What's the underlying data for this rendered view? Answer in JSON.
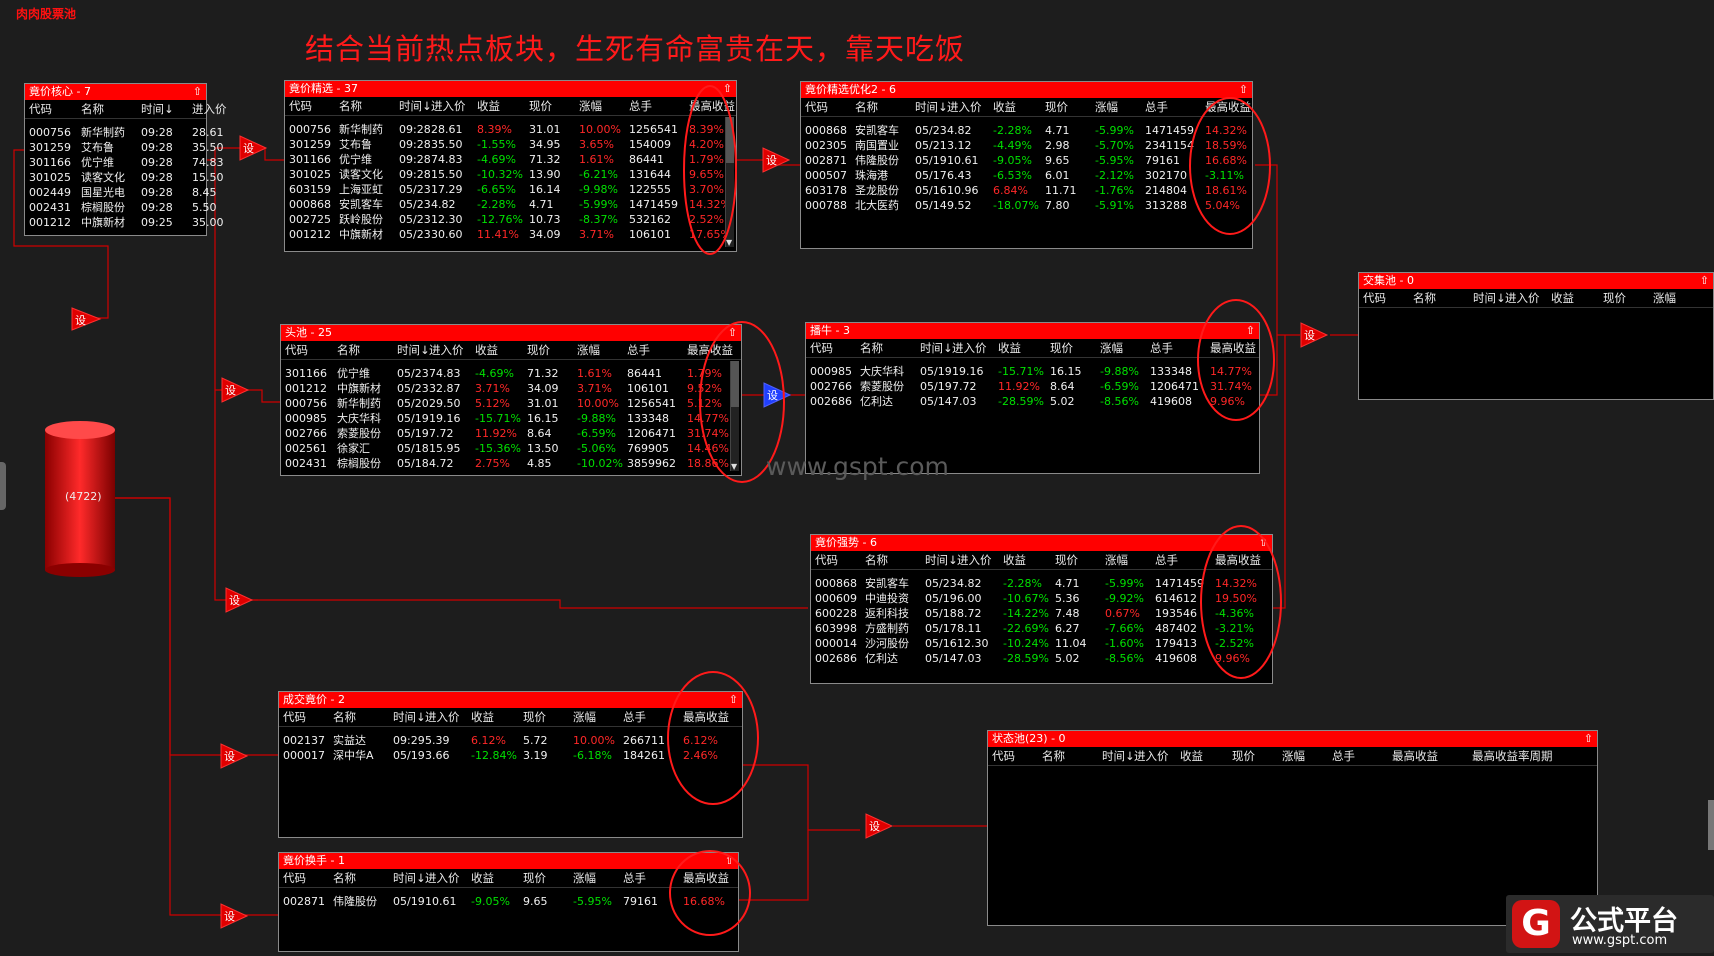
{
  "app_title": "肉肉股票池",
  "headline": "结合当前热点板块，生死有命富贵在天，靠天吃饭",
  "watermark": "www.gspt.com",
  "database": {
    "label": "(4722)"
  },
  "node_label": "设",
  "brand": {
    "logo_char": "G",
    "name": "公式平台",
    "url": "www.gspt.com"
  },
  "colors": {
    "accent": "#ff0000",
    "positive": "#ff2828",
    "negative": "#00e000",
    "background": "#1d1d1d"
  },
  "panels": {
    "hexin": {
      "title": "竟价核心 - 7",
      "cols": [
        "代码",
        "名称",
        "时间↓",
        "进入价"
      ],
      "rows": [
        [
          "000756",
          "新华制药",
          "09:28",
          "28.61"
        ],
        [
          "301259",
          "艾布鲁",
          "09:28",
          "35.50"
        ],
        [
          "301166",
          "优宁维",
          "09:28",
          "74.83"
        ],
        [
          "301025",
          "读客文化",
          "09:28",
          "15.50"
        ],
        [
          "002449",
          "国星光电",
          "09:28",
          "8.45"
        ],
        [
          "002431",
          "棕榈股份",
          "09:28",
          "5.50"
        ],
        [
          "001212",
          "中旗新材",
          "09:25",
          "35.00"
        ]
      ]
    },
    "jingxuan": {
      "title": "竟价精选 - 37",
      "cols": [
        "代码",
        "名称",
        "时间↓",
        "进入价",
        "收益",
        "现价",
        "涨幅",
        "总手",
        "最高收益"
      ],
      "rows": [
        [
          "000756",
          "新华制药",
          "09:28",
          "28.61",
          "8.39%",
          "31.01",
          "10.00%",
          "1256541",
          "8.39%"
        ],
        [
          "301259",
          "艾布鲁",
          "09:28",
          "35.50",
          "-1.55%",
          "34.95",
          "3.65%",
          "154009",
          "4.20%"
        ],
        [
          "301166",
          "优宁维",
          "09:28",
          "74.83",
          "-4.69%",
          "71.32",
          "1.61%",
          "86441",
          "1.79%"
        ],
        [
          "301025",
          "读客文化",
          "09:28",
          "15.50",
          "-10.32%",
          "13.90",
          "-6.21%",
          "131644",
          "9.65%"
        ],
        [
          "603159",
          "上海亚虹",
          "05/23",
          "17.29",
          "-6.65%",
          "16.14",
          "-9.98%",
          "122555",
          "3.70%"
        ],
        [
          "000868",
          "安凯客车",
          "05/23",
          "4.82",
          "-2.28%",
          "4.71",
          "-5.99%",
          "1471459",
          "14.32%"
        ],
        [
          "002725",
          "跃岭股份",
          "05/23",
          "12.30",
          "-12.76%",
          "10.73",
          "-8.37%",
          "532162",
          "2.52%"
        ],
        [
          "001212",
          "中旗新材",
          "05/23",
          "30.60",
          "11.41%",
          "34.09",
          "3.71%",
          "106101",
          "17.65%"
        ]
      ]
    },
    "youhua": {
      "title": "竟价精选优化2 - 6",
      "cols": [
        "代码",
        "名称",
        "时间↓",
        "进入价",
        "收益",
        "现价",
        "涨幅",
        "总手",
        "最高收益"
      ],
      "rows": [
        [
          "000868",
          "安凯客车",
          "05/23",
          "4.82",
          "-2.28%",
          "4.71",
          "-5.99%",
          "1471459",
          "14.32%"
        ],
        [
          "002305",
          "南国置业",
          "05/21",
          "3.12",
          "-4.49%",
          "2.98",
          "-5.70%",
          "2341154",
          "18.59%"
        ],
        [
          "002871",
          "伟隆股份",
          "05/19",
          "10.61",
          "-9.05%",
          "9.65",
          "-5.95%",
          "79161",
          "16.68%"
        ],
        [
          "000507",
          "珠海港",
          "05/17",
          "6.43",
          "-6.53%",
          "6.01",
          "-2.12%",
          "302170",
          "-3.11%"
        ],
        [
          "603178",
          "圣龙股份",
          "05/16",
          "10.96",
          "6.84%",
          "11.71",
          "-1.76%",
          "214804",
          "18.61%"
        ],
        [
          "000788",
          "北大医药",
          "05/14",
          "9.52",
          "-18.07%",
          "7.80",
          "-5.91%",
          "313288",
          "5.04%"
        ]
      ]
    },
    "jiaoji": {
      "title": "交集池 - 0",
      "cols": [
        "代码",
        "名称",
        "时间↓",
        "进入价",
        "收益",
        "现价",
        "涨幅"
      ],
      "rows": []
    },
    "toutou": {
      "title": "头池 - 25",
      "cols": [
        "代码",
        "名称",
        "时间↓",
        "进入价",
        "收益",
        "现价",
        "涨幅",
        "总手",
        "最高收益"
      ],
      "rows": [
        [
          "301166",
          "优宁维",
          "05/23",
          "74.83",
          "-4.69%",
          "71.32",
          "1.61%",
          "86441",
          "1.79%"
        ],
        [
          "001212",
          "中旗新材",
          "05/23",
          "32.87",
          "3.71%",
          "34.09",
          "3.71%",
          "106101",
          "9.52%"
        ],
        [
          "000756",
          "新华制药",
          "05/20",
          "29.50",
          "5.12%",
          "31.01",
          "10.00%",
          "1256541",
          "5.12%"
        ],
        [
          "000985",
          "大庆华科",
          "05/19",
          "19.16",
          "-15.71%",
          "16.15",
          "-9.88%",
          "133348",
          "14.77%"
        ],
        [
          "002766",
          "索菱股份",
          "05/19",
          "7.72",
          "11.92%",
          "8.64",
          "-6.59%",
          "1206471",
          "31.74%"
        ],
        [
          "002561",
          "徐家汇",
          "05/18",
          "15.95",
          "-15.36%",
          "13.50",
          "-5.06%",
          "769905",
          "14.46%"
        ],
        [
          "002431",
          "棕榈股份",
          "05/18",
          "4.72",
          "2.75%",
          "4.85",
          "-10.02%",
          "3859962",
          "18.86%"
        ]
      ]
    },
    "bozhong": {
      "title": "播牛 - 3",
      "cols": [
        "代码",
        "名称",
        "时间↓",
        "进入价",
        "收益",
        "现价",
        "涨幅",
        "总手",
        "最高收益"
      ],
      "rows": [
        [
          "000985",
          "大庆华科",
          "05/19",
          "19.16",
          "-15.71%",
          "16.15",
          "-9.88%",
          "133348",
          "14.77%"
        ],
        [
          "002766",
          "索菱股份",
          "05/19",
          "7.72",
          "11.92%",
          "8.64",
          "-6.59%",
          "1206471",
          "31.74%"
        ],
        [
          "002686",
          "亿利达",
          "05/14",
          "7.03",
          "-28.59%",
          "5.02",
          "-8.56%",
          "419608",
          "9.96%"
        ]
      ]
    },
    "qiangshi": {
      "title": "竟价强势 - 6",
      "cols": [
        "代码",
        "名称",
        "时间↓",
        "进入价",
        "收益",
        "现价",
        "涨幅",
        "总手",
        "最高收益"
      ],
      "rows": [
        [
          "000868",
          "安凯客车",
          "05/23",
          "4.82",
          "-2.28%",
          "4.71",
          "-5.99%",
          "1471459",
          "14.32%"
        ],
        [
          "000609",
          "中迪投资",
          "05/19",
          "6.00",
          "-10.67%",
          "5.36",
          "-9.92%",
          "614612",
          "19.50%"
        ],
        [
          "600228",
          "返利科技",
          "05/18",
          "8.72",
          "-14.22%",
          "7.48",
          "0.67%",
          "193546",
          "-4.36%"
        ],
        [
          "603998",
          "方盛制药",
          "05/17",
          "8.11",
          "-22.69%",
          "6.27",
          "-7.66%",
          "487402",
          "-3.21%"
        ],
        [
          "000014",
          "沙河股份",
          "05/16",
          "12.30",
          "-10.24%",
          "11.04",
          "-1.60%",
          "179413",
          "-2.52%"
        ],
        [
          "002686",
          "亿利达",
          "05/14",
          "7.03",
          "-28.59%",
          "5.02",
          "-8.56%",
          "419608",
          "9.96%"
        ]
      ]
    },
    "chengjiao": {
      "title": "成交竟价 - 2",
      "cols": [
        "代码",
        "名称",
        "时间↓",
        "进入价",
        "收益",
        "现价",
        "涨幅",
        "总手",
        "最高收益"
      ],
      "rows": [
        [
          "002137",
          "实益达",
          "09:29",
          "5.39",
          "6.12%",
          "5.72",
          "10.00%",
          "266711",
          "6.12%"
        ],
        [
          "000017",
          "深中华A",
          "05/19",
          "3.66",
          "-12.84%",
          "3.19",
          "-6.18%",
          "184261",
          "2.46%"
        ]
      ]
    },
    "huanshou": {
      "title": "竟价换手 - 1",
      "cols": [
        "代码",
        "名称",
        "时间↓",
        "进入价",
        "收益",
        "现价",
        "涨幅",
        "总手",
        "最高收益"
      ],
      "rows": [
        [
          "002871",
          "伟隆股份",
          "05/19",
          "10.61",
          "-9.05%",
          "9.65",
          "-5.95%",
          "79161",
          "16.68%"
        ]
      ]
    },
    "zhuangtai": {
      "title": "状态池(23) - 0",
      "cols": [
        "代码",
        "名称",
        "时间↓",
        "进入价",
        "收益",
        "现价",
        "涨幅",
        "总手",
        "最高收益",
        "最高收益率周期"
      ],
      "rows": []
    }
  }
}
